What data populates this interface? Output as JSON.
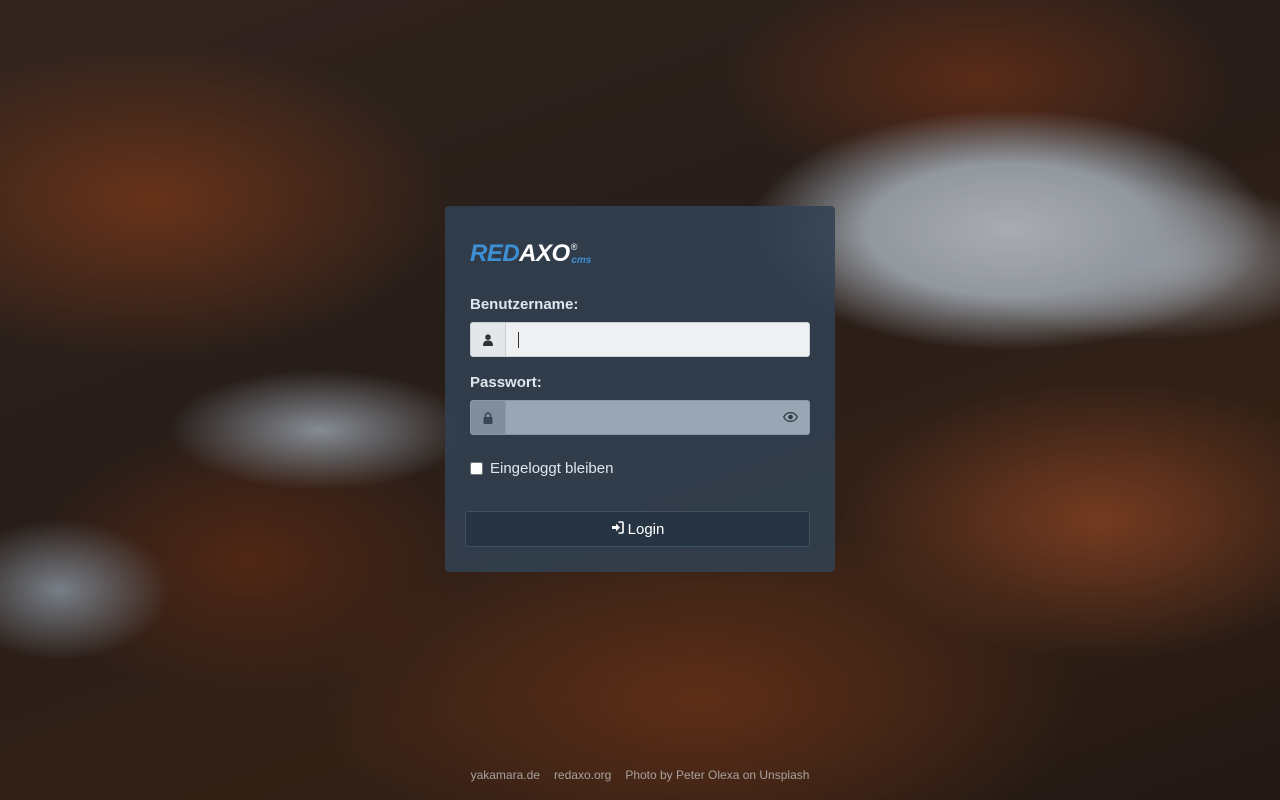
{
  "logo": {
    "red": "RED",
    "axo": "AXO",
    "reg": "®",
    "cms": "cms"
  },
  "form": {
    "username_label": "Benutzername:",
    "username_value": "",
    "password_label": "Passwort:",
    "password_value": "",
    "remember_label": "Eingeloggt bleiben",
    "remember_checked": false,
    "login_label": "Login"
  },
  "icons": {
    "username": "user-icon",
    "password": "lock-icon",
    "reveal": "eye-icon",
    "login": "sign-in-icon"
  },
  "footer": {
    "links": [
      "yakamara.de",
      "redaxo.org",
      "Photo by Peter Olexa on Unsplash"
    ]
  },
  "colors": {
    "brand_blue": "#3d8fd4",
    "panel": "#324152",
    "button": "#263444"
  }
}
